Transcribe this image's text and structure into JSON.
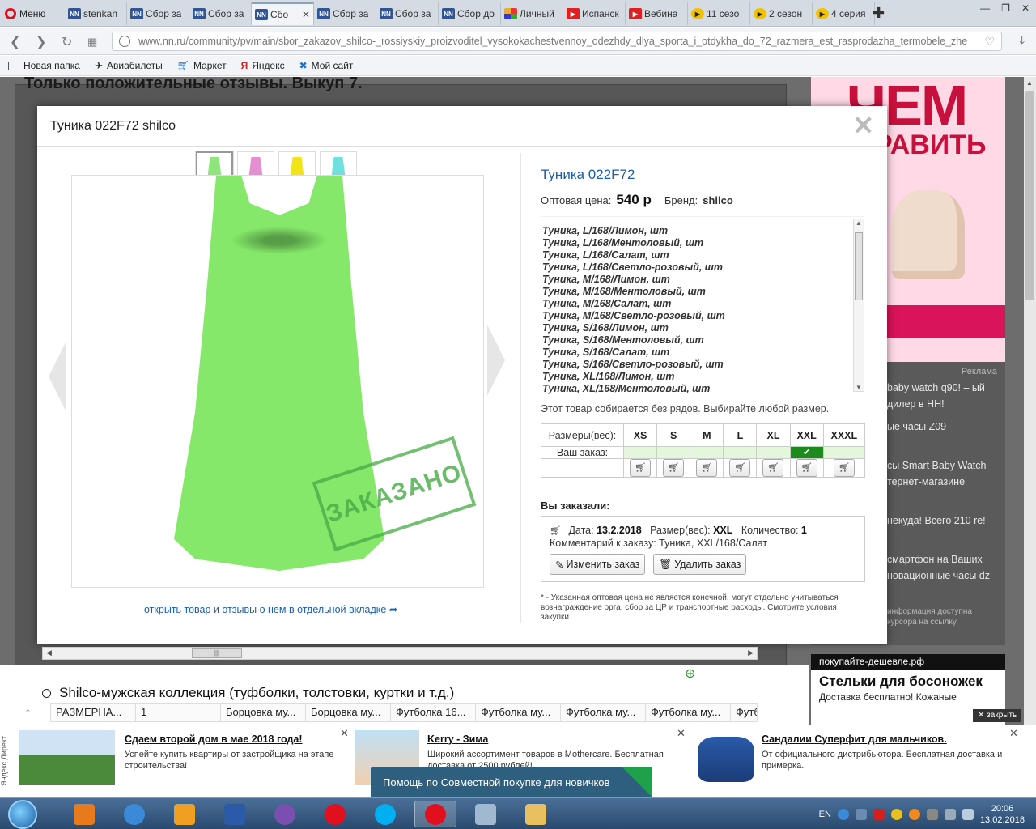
{
  "browser": {
    "menu_label": "Меню",
    "tabs": [
      {
        "label": "stenkan",
        "icon": "nn-icon"
      },
      {
        "label": "Сбор за",
        "icon": "nn-icon"
      },
      {
        "label": "Сбор за",
        "icon": "nn-icon"
      },
      {
        "label": "Сбо",
        "icon": "nn-icon",
        "active": true
      },
      {
        "label": "Сбор за",
        "icon": "nn-icon"
      },
      {
        "label": "Сбор за",
        "icon": "nn-icon"
      },
      {
        "label": "Сбор до",
        "icon": "nn-icon"
      },
      {
        "label": "Личный",
        "icon": "google-icon"
      },
      {
        "label": "Испанск",
        "icon": "youtube-icon"
      },
      {
        "label": "Вебина",
        "icon": "youtube-icon"
      },
      {
        "label": "11 сезо",
        "icon": "play-icon"
      },
      {
        "label": "2 сезон",
        "icon": "play-icon"
      },
      {
        "label": "4 серия",
        "icon": "play-icon"
      }
    ],
    "url": "www.nn.ru/community/pv/main/sbor_zakazov_shilco-_rossiyskiy_proizvoditel_vysokokachestvennoy_odezhdy_dlya_sporta_i_otdykha_do_72_razmera_est_rasprodazha_termobele_zhe",
    "bookmarks": [
      "Новая папка",
      "Авиабилеты",
      "Маркет",
      "Яндекс",
      "Мой сайт"
    ]
  },
  "page": {
    "title": "Только положительные отзывы. Выкуп 7.",
    "section_title": "Shilco-мужская коллекция (туфболки, толстовки, куртки и т.д.)",
    "row_cells": [
      "РАЗМЕРНА...",
      "1",
      "Борцовка му...",
      "Борцовка му...",
      "Футболка 16...",
      "Футболка му...",
      "Футболка му...",
      "Футболка му...",
      "Футб"
    ]
  },
  "modal": {
    "title": "Туника 022F72 shilco",
    "product_name": "Туника 022F72",
    "price_label": "Оптовая цена:",
    "price": "540 р",
    "brand_label": "Бренд:",
    "brand": "shilco",
    "stamp_text": "ЗАКАЗАНО",
    "thumb_colors": [
      "#8ee57a",
      "#e38fd2",
      "#f3e41a",
      "#6fe0dc"
    ],
    "variants": [
      "Туника, L/168/Лимон, шт",
      "Туника, L/168/Ментоловый, шт",
      "Туника, L/168/Салат, шт",
      "Туника, L/168/Светло-розовый, шт",
      "Туника, M/168/Лимон, шт",
      "Туника, M/168/Ментоловый, шт",
      "Туника, M/168/Салат, шт",
      "Туника, M/168/Светло-розовый, шт",
      "Туника, S/168/Лимон, шт",
      "Туника, S/168/Ментоловый, шт",
      "Туника, S/168/Салат, шт",
      "Туника, S/168/Светло-розовый, шт",
      "Туника, XL/168/Лимон, шт",
      "Туника, XL/168/Ментоловый, шт"
    ],
    "size_note": "Этот товар собирается без рядов. Выбирайте любой размер.",
    "sizes_header": "Размеры(вес):",
    "sizes": [
      "XS",
      "S",
      "M",
      "L",
      "XL",
      "XXL",
      "XXXL"
    ],
    "your_order_label": "Ваш заказ:",
    "ordered_size_index": 5,
    "ordered_title": "Вы заказали:",
    "order": {
      "date_label": "Дата:",
      "date": "13.2.2018",
      "size_label": "Размер(вес):",
      "size": "XXL",
      "qty_label": "Количество:",
      "qty": "1",
      "comment": "Комментарий к заказу: Туника, XXL/168/Салат"
    },
    "edit_button": "Изменить заказ",
    "delete_button": "Удалить заказ",
    "footnote": "* - Указанная оптовая цена не является конечной, могут отдельно учитываться вознаграждение орга, сбор за ЦР и транспортные расходы. Смотрите условия закупки.",
    "open_link": "открыть товар и отзывы о нем в отдельной вкладке"
  },
  "right_ads": {
    "banner_line1": "ЧЕМ",
    "banner_line2": "РАВИТЬ",
    "ads_label": "Реклама",
    "items": [
      "baby watch q90! – ый дилер в НН!",
      "ые часы Z09",
      "сы Smart Baby Watch тернет-магазине",
      "некуда! Всего 210 re!",
      "смартфон на Ваших новационные часы dz"
    ],
    "info_note": "информация доступна курсора на ссылку",
    "bottom_bar": "покупайте-дешевле.рф",
    "bottom_title": "Стельки для босоножек",
    "bottom_desc": "Доставка бесплатно! Кожаные",
    "close_label": "закрыть"
  },
  "bottom_ads": {
    "side_label": "Яндекс.Директ",
    "cards": [
      {
        "title": "Сдаем второй дом в мае 2018 года!",
        "desc": "Успейте купить квартиры от застройщика на этапе строительства!"
      },
      {
        "title": "Kerry - Зима",
        "desc": "Широкий ассортимент товаров в Mothercare. Бесплатная доставка от 2500 рублей!"
      },
      {
        "title": "Сандалии Суперфит для мальчиков.",
        "desc": "От официального дистрибьютора. Бесплатная доставка и примерка."
      }
    ],
    "help_button": "Помощь по Совместной покупке для новичков"
  },
  "taskbar": {
    "lang": "EN",
    "time": "20:06",
    "date": "13.02.2018"
  }
}
